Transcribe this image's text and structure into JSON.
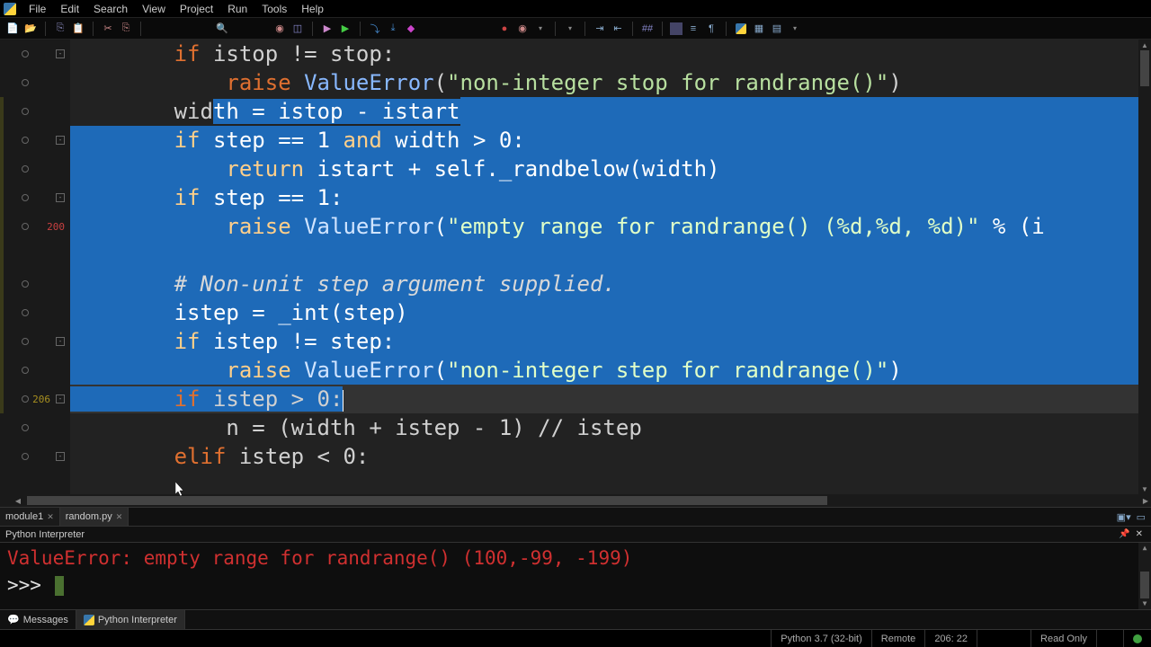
{
  "menubar": {
    "items": [
      "File",
      "Edit",
      "Search",
      "View",
      "Project",
      "Run",
      "Tools",
      "Help"
    ]
  },
  "toolbar": {
    "groups": [
      [
        "new-file-icon",
        "open-file-icon"
      ],
      [
        "copy-icon",
        "paste-icon",
        "undo-icon",
        "cut-icon",
        "copy2-icon"
      ],
      [
        "search-icon"
      ],
      [
        "breakpoint-list-icon",
        "watch-icon"
      ],
      [
        "run-icon",
        "play-icon"
      ],
      [
        "step-over-icon",
        "step-into-icon",
        "step-out-icon"
      ],
      [
        "record-icon",
        "record-stop-icon",
        "dropdown-icon"
      ],
      [
        "indent-icon",
        "outdent-icon",
        "comment-icon"
      ],
      [
        "toggle-icon",
        "numbers-icon",
        "pilcrow-icon"
      ],
      [
        "python-icon",
        "windows-icon",
        "layout-icon"
      ]
    ]
  },
  "gutter": {
    "rows": [
      {
        "line": "",
        "bp": true,
        "fold": "-"
      },
      {
        "line": "",
        "bp": true
      },
      {
        "line": "",
        "bp": true
      },
      {
        "line": "",
        "bp": true,
        "fold": "-"
      },
      {
        "line": "",
        "bp": true
      },
      {
        "line": "",
        "bp": true,
        "fold": "-"
      },
      {
        "line": "200",
        "red": true,
        "bp": true
      },
      {
        "line": "",
        "bp": false
      },
      {
        "line": "",
        "bp": true
      },
      {
        "line": "",
        "bp": true
      },
      {
        "line": "",
        "bp": true,
        "fold": "-"
      },
      {
        "line": "",
        "bp": true
      },
      {
        "line": "206",
        "bp": true,
        "fold": "-"
      },
      {
        "line": "",
        "bp": true
      },
      {
        "line": "",
        "bp": true,
        "fold": "-"
      }
    ]
  },
  "code": {
    "lines": [
      {
        "sel": false,
        "current": false,
        "parts": [
          {
            "t": "        ",
            "c": "txt"
          },
          {
            "t": "if",
            "c": "kw"
          },
          {
            "t": " istop != stop:",
            "c": "txt"
          }
        ]
      },
      {
        "sel": false,
        "current": false,
        "parts": [
          {
            "t": "            ",
            "c": "txt"
          },
          {
            "t": "raise",
            "c": "kw"
          },
          {
            "t": " ",
            "c": "txt"
          },
          {
            "t": "ValueError",
            "c": "fn"
          },
          {
            "t": "(",
            "c": "txt"
          },
          {
            "t": "\"non-integer stop for randrange()\"",
            "c": "str"
          },
          {
            "t": ")",
            "c": "txt"
          }
        ]
      },
      {
        "sel": true,
        "startCol": 11,
        "parts": [
          {
            "t": "        wid",
            "c": "txt"
          },
          {
            "t": "th = istop - istart",
            "c": "txt-sel"
          }
        ]
      },
      {
        "sel": true,
        "parts": [
          {
            "t": "        ",
            "c": "txt-sel"
          },
          {
            "t": "if",
            "c": "kw-sel"
          },
          {
            "t": " step == ",
            "c": "txt-sel"
          },
          {
            "t": "1",
            "c": "txt-sel"
          },
          {
            "t": " ",
            "c": "txt-sel"
          },
          {
            "t": "and",
            "c": "kw-sel"
          },
          {
            "t": " width > ",
            "c": "txt-sel"
          },
          {
            "t": "0",
            "c": "txt-sel"
          },
          {
            "t": ":",
            "c": "txt-sel"
          }
        ]
      },
      {
        "sel": true,
        "parts": [
          {
            "t": "            ",
            "c": "txt-sel"
          },
          {
            "t": "return",
            "c": "kw-sel"
          },
          {
            "t": " istart + self._randbelow(width)",
            "c": "txt-sel"
          }
        ]
      },
      {
        "sel": true,
        "parts": [
          {
            "t": "        ",
            "c": "txt-sel"
          },
          {
            "t": "if",
            "c": "kw-sel"
          },
          {
            "t": " step == ",
            "c": "txt-sel"
          },
          {
            "t": "1",
            "c": "txt-sel"
          },
          {
            "t": ":",
            "c": "txt-sel"
          }
        ]
      },
      {
        "sel": true,
        "parts": [
          {
            "t": "            ",
            "c": "txt-sel"
          },
          {
            "t": "raise",
            "c": "kw-sel"
          },
          {
            "t": " ",
            "c": "txt-sel"
          },
          {
            "t": "ValueError",
            "c": "fn-sel"
          },
          {
            "t": "(",
            "c": "txt-sel"
          },
          {
            "t": "\"empty range for randrange() (%d,%d, %d)\"",
            "c": "str-sel"
          },
          {
            "t": " % (i",
            "c": "txt-sel"
          }
        ]
      },
      {
        "sel": true,
        "parts": [
          {
            "t": "",
            "c": "txt-sel"
          }
        ]
      },
      {
        "sel": true,
        "parts": [
          {
            "t": "        ",
            "c": "txt-sel"
          },
          {
            "t": "# Non-unit step argument supplied.",
            "c": "cmt-sel"
          }
        ]
      },
      {
        "sel": true,
        "parts": [
          {
            "t": "        istep = _int(step)",
            "c": "txt-sel"
          }
        ]
      },
      {
        "sel": true,
        "parts": [
          {
            "t": "        ",
            "c": "txt-sel"
          },
          {
            "t": "if",
            "c": "kw-sel"
          },
          {
            "t": " istep != step:",
            "c": "txt-sel"
          }
        ]
      },
      {
        "sel": true,
        "parts": [
          {
            "t": "            ",
            "c": "txt-sel"
          },
          {
            "t": "raise",
            "c": "kw-sel"
          },
          {
            "t": " ",
            "c": "txt-sel"
          },
          {
            "t": "ValueError",
            "c": "fn-sel"
          },
          {
            "t": "(",
            "c": "txt-sel"
          },
          {
            "t": "\"non-integer step for randrange()\"",
            "c": "str-sel"
          },
          {
            "t": ")",
            "c": "txt-sel"
          }
        ]
      },
      {
        "sel": false,
        "current": true,
        "caretCol": 21,
        "parts": [
          {
            "t": "        ",
            "c": "txt"
          },
          {
            "t": "if",
            "c": "kw"
          },
          {
            "t": " istep > ",
            "c": "txt"
          },
          {
            "t": "0",
            "c": "txt"
          },
          {
            "t": ":",
            "c": "txt"
          }
        ]
      },
      {
        "sel": false,
        "current": false,
        "parts": [
          {
            "t": "            n = (width + istep - ",
            "c": "txt"
          },
          {
            "t": "1",
            "c": "txt"
          },
          {
            "t": ") // istep",
            "c": "txt"
          }
        ]
      },
      {
        "sel": false,
        "current": false,
        "parts": [
          {
            "t": "        ",
            "c": "txt"
          },
          {
            "t": "elif",
            "c": "kw"
          },
          {
            "t": " istep < ",
            "c": "txt"
          },
          {
            "t": "0",
            "c": "txt"
          },
          {
            "t": ":",
            "c": "txt"
          }
        ]
      }
    ]
  },
  "tabs": {
    "files": [
      {
        "name": "module1",
        "active": false
      },
      {
        "name": "random.py",
        "active": true
      }
    ]
  },
  "panel": {
    "title": "Python Interpreter"
  },
  "console": {
    "lines": [
      {
        "c": "err",
        "t": "ValueError: empty range for randrange() (100,-99, -199)"
      },
      {
        "c": "prompt",
        "t": ">>> "
      }
    ]
  },
  "bottom_tabs": {
    "items": [
      {
        "label": "Messages",
        "active": false,
        "icon": "chat-icon"
      },
      {
        "label": "Python Interpreter",
        "active": true,
        "icon": "python-icon"
      }
    ]
  },
  "status": {
    "python": "Python 3.7 (32-bit)",
    "remote": "Remote",
    "pos": "206: 22",
    "readonly": "Read Only"
  }
}
